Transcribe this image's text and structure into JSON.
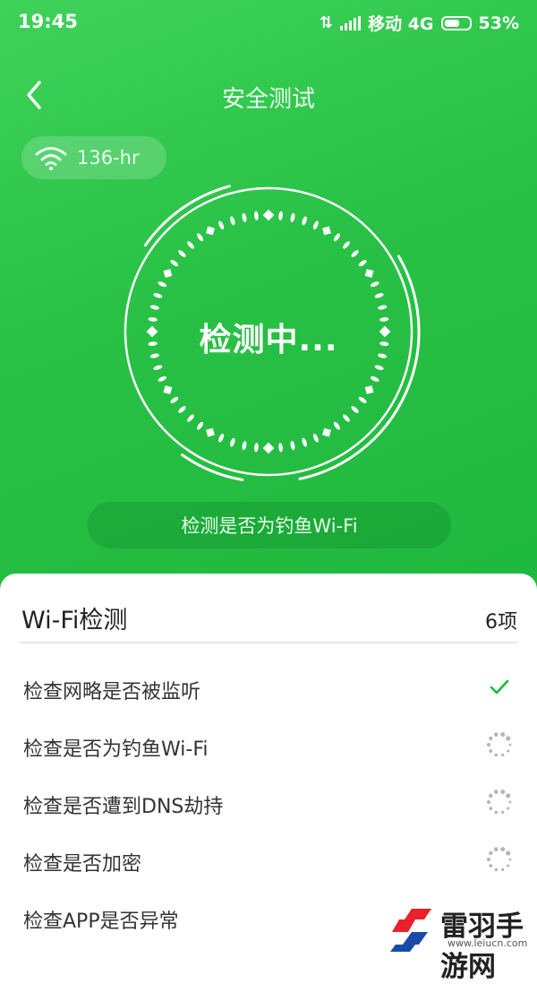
{
  "status_bar": {
    "time": "19:45",
    "carrier": "移动 4G",
    "battery": "53%"
  },
  "header": {
    "title": "安全测试",
    "back_icon": "chevron-left-icon"
  },
  "network": {
    "icon": "wifi-icon",
    "name": "136-hr"
  },
  "scanner": {
    "status_text": "检测中...",
    "current_check": "检测是否为钓鱼Wi-Fi"
  },
  "panel": {
    "title": "Wi-Fi检测",
    "count": "6项",
    "items": [
      {
        "label": "检查网略是否被监听",
        "status": "done"
      },
      {
        "label": "检查是否为钓鱼Wi-Fi",
        "status": "pending"
      },
      {
        "label": "检查是否遭到DNS劫持",
        "status": "pending"
      },
      {
        "label": "检查是否加密",
        "status": "pending"
      },
      {
        "label": "检查APP是否异常",
        "status": "pending"
      }
    ]
  },
  "watermark": {
    "text": "雷羽手游网",
    "url": "www.leiucn.com"
  },
  "colors": {
    "primary_green": "#2bc249",
    "check_green": "#20b83c",
    "spinner_gray": "#b5b5b5",
    "logo_red": "#e8212a",
    "logo_blue": "#1a4aa8"
  }
}
